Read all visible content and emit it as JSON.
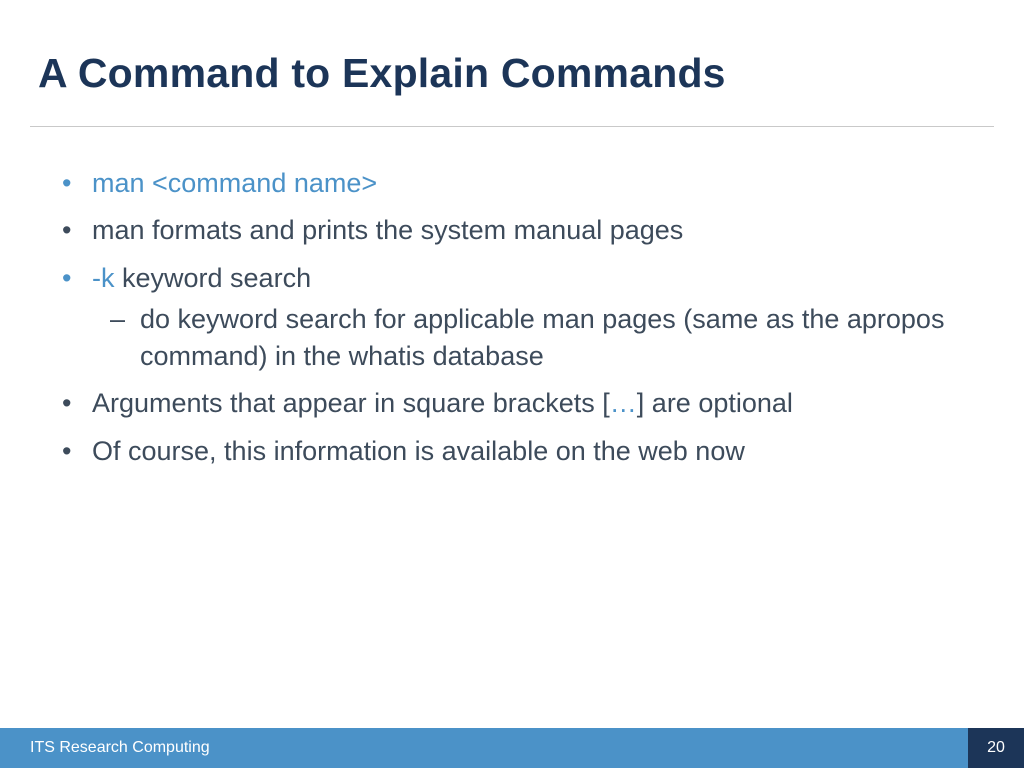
{
  "title": "A Command to Explain Commands",
  "bullets": {
    "b1": "man <command name>",
    "b2": "man formats and prints the system manual pages",
    "b3_prefix": "-k",
    "b3_rest": " keyword search",
    "b3_sub": "do keyword search for applicable man pages (same as the apropos command) in the whatis database",
    "b4_a": "Arguments that appear in square brackets [",
    "b4_mid": "…",
    "b4_b": "] are optional",
    "b5": "Of course, this information is available on the web now"
  },
  "footer": {
    "org": "ITS Research Computing",
    "page": "20"
  }
}
